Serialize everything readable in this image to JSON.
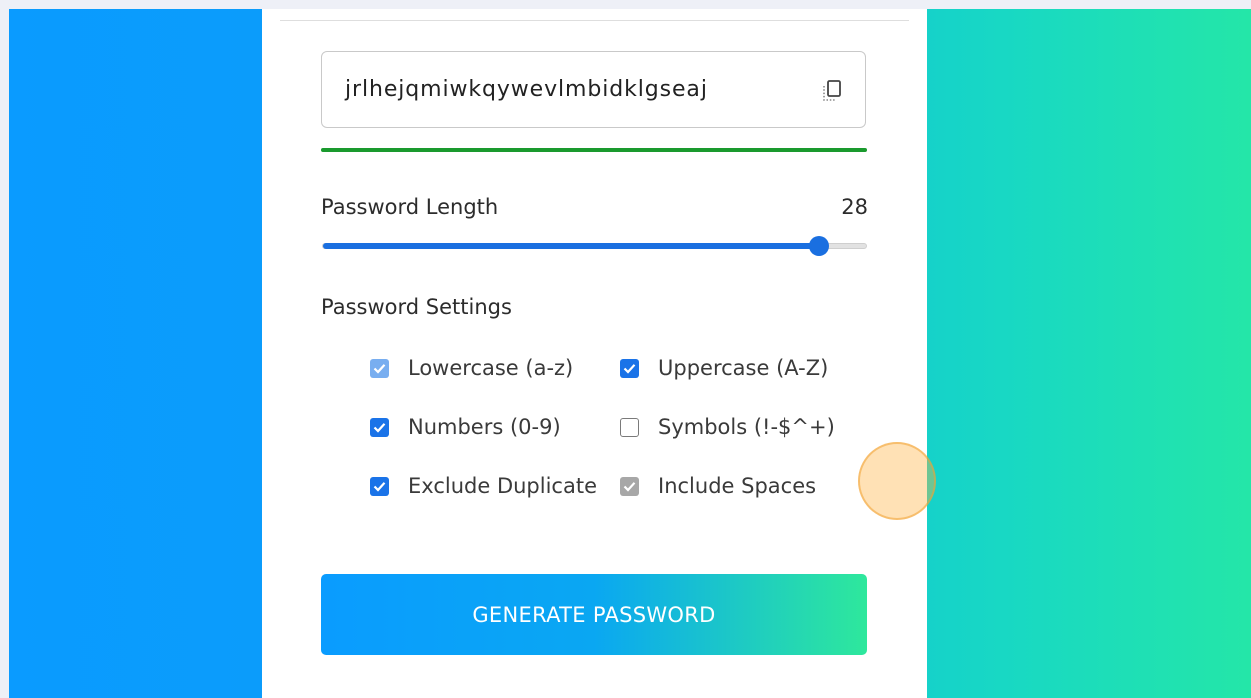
{
  "password": {
    "value": "jrlhejqmiwkqywevlmbidklgseaj",
    "strength_color": "#1a9a2e"
  },
  "length": {
    "label": "Password Length",
    "value": "28",
    "slider_fraction": 0.91,
    "accent_color": "#1a6fe0"
  },
  "settings": {
    "title": "Password Settings",
    "options": [
      {
        "label": "Lowercase (a-z)",
        "checked": true
      },
      {
        "label": "Uppercase (A-Z)",
        "checked": true
      },
      {
        "label": "Numbers (0-9)",
        "checked": true
      },
      {
        "label": "Symbols (!-$^+)",
        "checked": false
      },
      {
        "label": "Exclude Duplicate",
        "checked": true
      },
      {
        "label": "Include Spaces",
        "checked": true
      }
    ]
  },
  "generate_button": {
    "label": "GENERATE PASSWORD"
  },
  "icons": {
    "copy": "copy-icon",
    "check": "check-icon"
  }
}
